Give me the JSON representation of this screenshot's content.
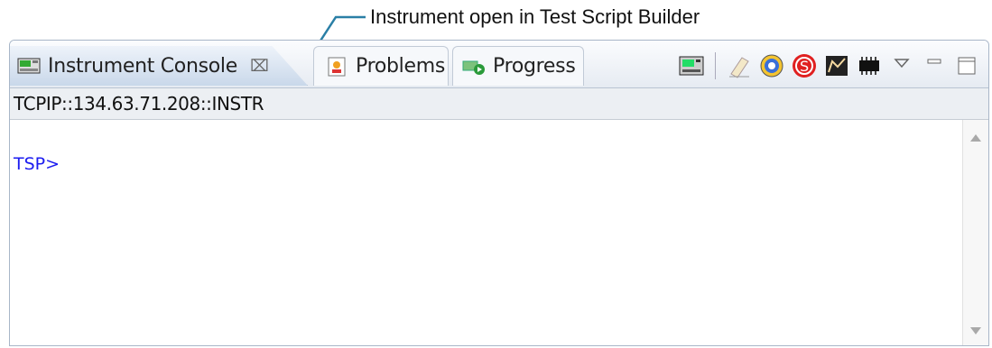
{
  "annotation": {
    "text": "Instrument open in Test Script Builder"
  },
  "tabs": [
    {
      "label": "Instrument Console",
      "close_glyph": "⌧",
      "icon": "instrument-console-icon",
      "active": true
    },
    {
      "label": "Problems",
      "icon": "problems-icon",
      "active": false
    },
    {
      "label": "Progress",
      "icon": "progress-icon",
      "active": false
    }
  ],
  "toolbar": {
    "icons": [
      "instrument-icon",
      "eraser-icon",
      "target-icon",
      "stop-s-icon",
      "graph-icon",
      "chip-icon",
      "view-menu-icon",
      "minimize-icon",
      "maximize-icon"
    ]
  },
  "address": {
    "value": "TCPIP::134.63.71.208::INSTR"
  },
  "console": {
    "prompt": "TSP>"
  },
  "colors": {
    "prompt": "#1c1cf0",
    "arrow": "#2a7fa6",
    "tab_active": "#c9d8ea"
  }
}
